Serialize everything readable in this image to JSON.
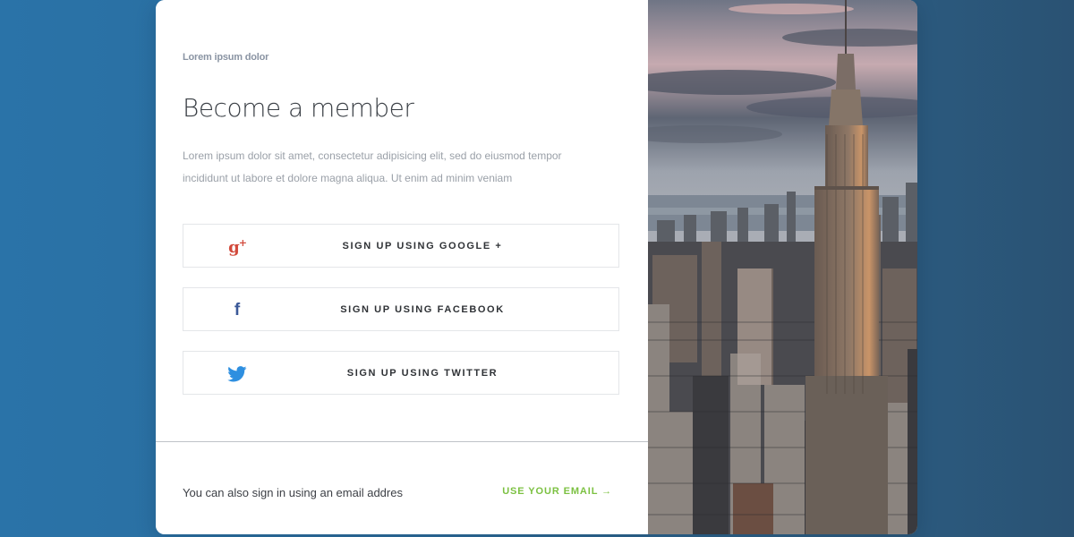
{
  "card": {
    "eyebrow": "Lorem ipsum dolor",
    "title": "Become a member",
    "description": "Lorem ipsum dolor sit amet, consectetur adipisicing elit, sed do eiusmod tempor incididunt ut labore et dolore magna aliqua. Ut enim ad minim veniam"
  },
  "buttons": [
    {
      "label": "SIGN UP USING GOOGLE +",
      "icon": "google-plus-icon",
      "icon_text": "g+",
      "color": "#d24a3c"
    },
    {
      "label": "SIGN UP USING FACEBOOK",
      "icon": "facebook-icon",
      "icon_text": "f",
      "color": "#3b5998"
    },
    {
      "label": "SIGN UP USING TWITTER",
      "icon": "twitter-icon",
      "color": "#2e8fe0"
    }
  ],
  "footer": {
    "text": "You can also sign in using an email addres",
    "link": "USE YOUR EMAIL →",
    "link_color": "#7cc142"
  },
  "photo": {
    "subject": "city-skyline-image"
  }
}
